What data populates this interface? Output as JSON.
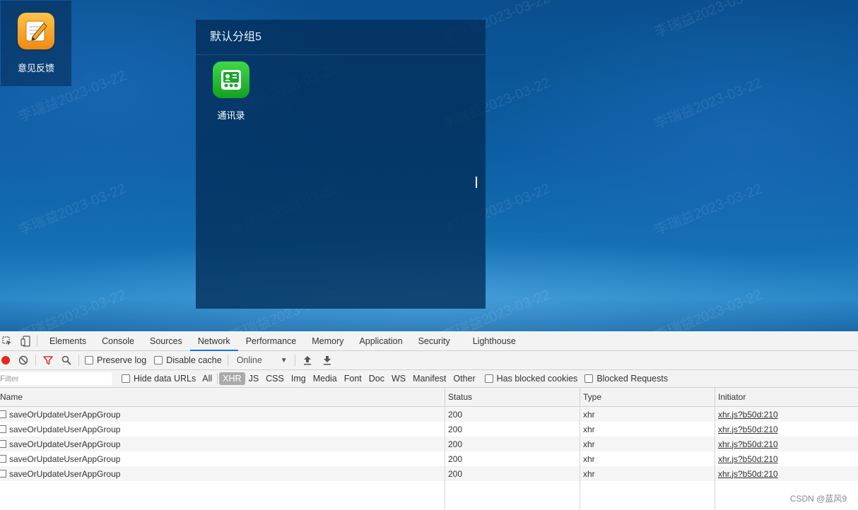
{
  "desktop": {
    "watermark_text": "李瑞益2023-03-22",
    "app": {
      "label": "意见反馈",
      "icon": "feedback-notepad-icon"
    },
    "group": {
      "title": "默认分组5",
      "apps": [
        {
          "label": "通讯录",
          "icon": "contacts-icon"
        }
      ]
    }
  },
  "devtools": {
    "tabs": [
      "Elements",
      "Console",
      "Sources",
      "Network",
      "Performance",
      "Memory",
      "Application",
      "Security",
      "Lighthouse"
    ],
    "active_tab": "Network",
    "toolbar": {
      "preserve_log": "Preserve log",
      "disable_cache": "Disable cache",
      "throttling": "Online"
    },
    "filter": {
      "placeholder": "Filter",
      "hide_data_urls": "Hide data URLs",
      "types": [
        "All",
        "XHR",
        "JS",
        "CSS",
        "Img",
        "Media",
        "Font",
        "Doc",
        "WS",
        "Manifest",
        "Other"
      ],
      "active_type": "XHR",
      "has_blocked_cookies": "Has blocked cookies",
      "blocked_requests": "Blocked Requests"
    },
    "columns": {
      "name": "Name",
      "status": "Status",
      "type": "Type",
      "initiator": "Initiator"
    },
    "rows": [
      {
        "name": "saveOrUpdateUserAppGroup",
        "status": "200",
        "type": "xhr",
        "initiator": "xhr.js?b50d:210"
      },
      {
        "name": "saveOrUpdateUserAppGroup",
        "status": "200",
        "type": "xhr",
        "initiator": "xhr.js?b50d:210"
      },
      {
        "name": "saveOrUpdateUserAppGroup",
        "status": "200",
        "type": "xhr",
        "initiator": "xhr.js?b50d:210"
      },
      {
        "name": "saveOrUpdateUserAppGroup",
        "status": "200",
        "type": "xhr",
        "initiator": "xhr.js?b50d:210"
      },
      {
        "name": "saveOrUpdateUserAppGroup",
        "status": "200",
        "type": "xhr",
        "initiator": "xhr.js?b50d:210"
      }
    ]
  },
  "footer_watermark": "CSDN @蓝风9",
  "colors": {
    "accent": "#1a73e8",
    "record": "#e8261c",
    "filter_active": "#d93025",
    "desktop_bg": "#0c5ea3"
  }
}
